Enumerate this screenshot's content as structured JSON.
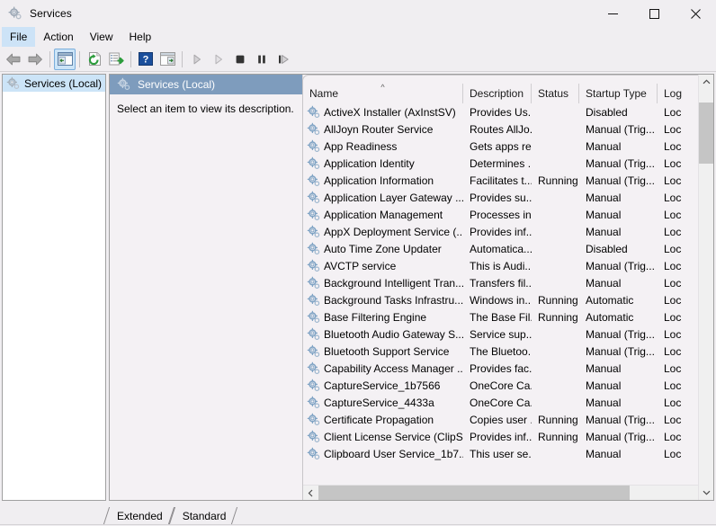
{
  "window": {
    "title": "Services",
    "icon": "services-gear-icon",
    "minimize_label": "—",
    "maximize_label": "□",
    "close_label": "✕"
  },
  "menu": {
    "items": [
      {
        "label": "File",
        "active": true
      },
      {
        "label": "Action",
        "active": false
      },
      {
        "label": "View",
        "active": false
      },
      {
        "label": "Help",
        "active": false
      }
    ]
  },
  "toolbar": {
    "buttons": [
      {
        "name": "back-arrow-icon",
        "kind": "back"
      },
      {
        "name": "forward-arrow-icon",
        "kind": "forward"
      },
      {
        "name": "separator-1",
        "kind": "sep"
      },
      {
        "name": "show-hide-console-tree-icon",
        "kind": "console-tree",
        "pressed": true
      },
      {
        "name": "separator-2",
        "kind": "sep"
      },
      {
        "name": "refresh-icon",
        "kind": "refresh"
      },
      {
        "name": "export-list-icon",
        "kind": "export"
      },
      {
        "name": "separator-3",
        "kind": "sep"
      },
      {
        "name": "help-icon",
        "kind": "help"
      },
      {
        "name": "show-hide-action-pane-icon",
        "kind": "action-pane"
      },
      {
        "name": "separator-4",
        "kind": "sep"
      },
      {
        "name": "start-service-icon",
        "kind": "play"
      },
      {
        "name": "resume-service-icon",
        "kind": "play2"
      },
      {
        "name": "stop-service-icon",
        "kind": "stop"
      },
      {
        "name": "pause-service-icon",
        "kind": "pause"
      },
      {
        "name": "restart-service-icon",
        "kind": "restart"
      }
    ]
  },
  "sidebar": {
    "items": [
      {
        "label": "Services (Local)",
        "icon": "services-gear-icon",
        "selected": true
      }
    ]
  },
  "content": {
    "header_title": "Services (Local)",
    "header_icon": "services-gear-icon",
    "description_text": "Select an item to view its description."
  },
  "list": {
    "columns": [
      {
        "key": "name",
        "label": "Name",
        "sorted": true,
        "sort_dir": "asc"
      },
      {
        "key": "desc",
        "label": "Description",
        "sorted": false
      },
      {
        "key": "status",
        "label": "Status",
        "sorted": false
      },
      {
        "key": "start",
        "label": "Startup Type",
        "sorted": false
      },
      {
        "key": "logon",
        "label": "Log",
        "sorted": false
      }
    ],
    "rows": [
      {
        "name": "ActiveX Installer (AxInstSV)",
        "desc": "Provides Us...",
        "status": "",
        "start": "Disabled",
        "logon": "Loc"
      },
      {
        "name": "AllJoyn Router Service",
        "desc": "Routes AllJo...",
        "status": "",
        "start": "Manual (Trig...",
        "logon": "Loc"
      },
      {
        "name": "App Readiness",
        "desc": "Gets apps re...",
        "status": "",
        "start": "Manual",
        "logon": "Loc"
      },
      {
        "name": "Application Identity",
        "desc": "Determines ...",
        "status": "",
        "start": "Manual (Trig...",
        "logon": "Loc"
      },
      {
        "name": "Application Information",
        "desc": "Facilitates t...",
        "status": "Running",
        "start": "Manual (Trig...",
        "logon": "Loc"
      },
      {
        "name": "Application Layer Gateway ...",
        "desc": "Provides su...",
        "status": "",
        "start": "Manual",
        "logon": "Loc"
      },
      {
        "name": "Application Management",
        "desc": "Processes in...",
        "status": "",
        "start": "Manual",
        "logon": "Loc"
      },
      {
        "name": "AppX Deployment Service (...",
        "desc": "Provides inf...",
        "status": "",
        "start": "Manual",
        "logon": "Loc"
      },
      {
        "name": "Auto Time Zone Updater",
        "desc": "Automatica...",
        "status": "",
        "start": "Disabled",
        "logon": "Loc"
      },
      {
        "name": "AVCTP service",
        "desc": "This is Audi...",
        "status": "",
        "start": "Manual (Trig...",
        "logon": "Loc"
      },
      {
        "name": "Background Intelligent Tran...",
        "desc": "Transfers fil...",
        "status": "",
        "start": "Manual",
        "logon": "Loc"
      },
      {
        "name": "Background Tasks Infrastru...",
        "desc": "Windows in...",
        "status": "Running",
        "start": "Automatic",
        "logon": "Loc"
      },
      {
        "name": "Base Filtering Engine",
        "desc": "The Base Fil...",
        "status": "Running",
        "start": "Automatic",
        "logon": "Loc"
      },
      {
        "name": "Bluetooth Audio Gateway S...",
        "desc": "Service sup...",
        "status": "",
        "start": "Manual (Trig...",
        "logon": "Loc"
      },
      {
        "name": "Bluetooth Support Service",
        "desc": "The Bluetoo...",
        "status": "",
        "start": "Manual (Trig...",
        "logon": "Loc"
      },
      {
        "name": "Capability Access Manager ...",
        "desc": "Provides fac...",
        "status": "",
        "start": "Manual",
        "logon": "Loc"
      },
      {
        "name": "CaptureService_1b7566",
        "desc": "OneCore Ca...",
        "status": "",
        "start": "Manual",
        "logon": "Loc"
      },
      {
        "name": "CaptureService_4433a",
        "desc": "OneCore Ca...",
        "status": "",
        "start": "Manual",
        "logon": "Loc"
      },
      {
        "name": "Certificate Propagation",
        "desc": "Copies user ...",
        "status": "Running",
        "start": "Manual (Trig...",
        "logon": "Loc"
      },
      {
        "name": "Client License Service (ClipS...",
        "desc": "Provides inf...",
        "status": "Running",
        "start": "Manual (Trig...",
        "logon": "Loc"
      },
      {
        "name": "Clipboard User Service_1b7...",
        "desc": "This user se...",
        "status": "",
        "start": "Manual",
        "logon": "Loc"
      }
    ],
    "vscroll": {
      "up_icon": "chevron-up-icon",
      "down_icon": "chevron-down-icon"
    },
    "hscroll": {
      "left_icon": "chevron-left-icon",
      "right_icon": "chevron-right-icon"
    }
  },
  "tabs": {
    "items": [
      {
        "label": "Extended",
        "selected": false
      },
      {
        "label": "Standard",
        "selected": true
      }
    ]
  },
  "colors": {
    "window_bg": "#f0eef1",
    "band_blue": "#7e9cbd",
    "selection_blue": "#cce4f7",
    "list_bg": "#f4f1f4",
    "scroll_thumb": "#c5c5c5"
  }
}
